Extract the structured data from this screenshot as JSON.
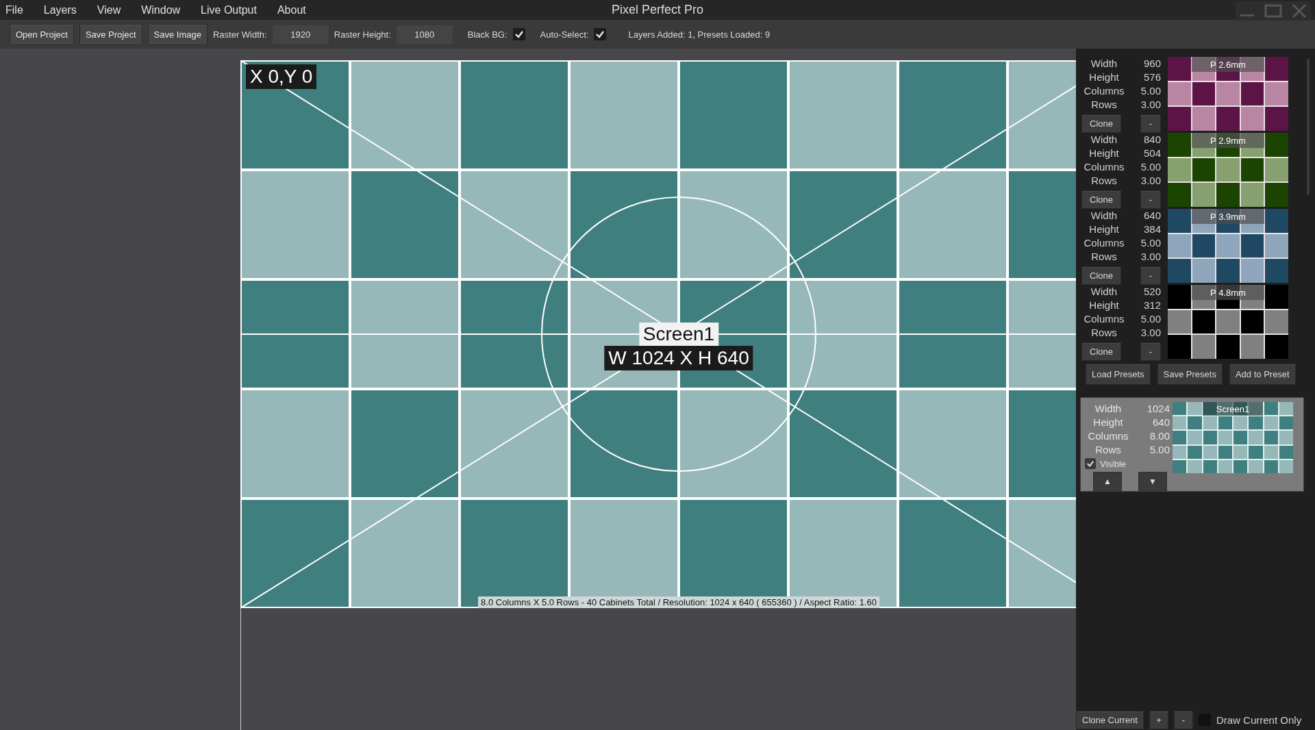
{
  "menu": [
    "File",
    "Layers",
    "View",
    "Window",
    "Live Output",
    "About"
  ],
  "title": "Pixel Perfect Pro",
  "toolbar": {
    "buttons": [
      "Open Project",
      "Save Project",
      "Save Image"
    ],
    "raster_width": {
      "label": "Raster Width:",
      "value": "1920"
    },
    "raster_height": {
      "label": "Raster Height:",
      "value": "1080"
    },
    "black_bg": {
      "label": "Black BG:",
      "checked": true
    },
    "auto_select": {
      "label": "Auto-Select:",
      "checked": true
    },
    "status": "Layers Added: 1, Presets Loaded: 9"
  },
  "canvas": {
    "origin_label": "X 0,Y 0",
    "screen_name": "Screen1",
    "size_label": "W 1024 X H 640",
    "status": "8.0 Columns X 5.0 Rows - 40 Cabinets Total / Resolution: 1024 x 640 ( 655360 ) / Aspect Ratio: 1.60"
  },
  "presets": [
    {
      "fields": [
        {
          "label": "Width",
          "value": "960"
        },
        {
          "label": "Height",
          "value": "576"
        },
        {
          "label": "Columns",
          "value": "5.00"
        },
        {
          "label": "Rows",
          "value": "3.00"
        }
      ],
      "pitch": "P 2.6mm",
      "tiles": [
        {
          "color": "#5c1346"
        },
        {
          "color": "#b886a3"
        }
      ],
      "clone": "Clone",
      "remove": "-"
    },
    {
      "fields": [
        {
          "label": "Width",
          "value": "840"
        },
        {
          "label": "Height",
          "value": "504"
        },
        {
          "label": "Columns",
          "value": "5.00"
        },
        {
          "label": "Rows",
          "value": "3.00"
        }
      ],
      "pitch": "P 2.9mm",
      "tiles": [
        {
          "color": "#1a4400"
        },
        {
          "color": "#86a070"
        }
      ],
      "clone": "Clone",
      "remove": "-"
    },
    {
      "fields": [
        {
          "label": "Width",
          "value": "640"
        },
        {
          "label": "Height",
          "value": "384"
        },
        {
          "label": "Columns",
          "value": "5.00"
        },
        {
          "label": "Rows",
          "value": "3.00"
        }
      ],
      "pitch": "P 3.9mm",
      "tiles": [
        {
          "color": "#1f4862"
        },
        {
          "color": "#8ea6bb"
        }
      ],
      "clone": "Clone",
      "remove": "-"
    },
    {
      "fields": [
        {
          "label": "Width",
          "value": "520"
        },
        {
          "label": "Height",
          "value": "312"
        },
        {
          "label": "Columns",
          "value": "5.00"
        },
        {
          "label": "Rows",
          "value": "3.00"
        }
      ],
      "pitch": "P 4.8mm",
      "tiles": [
        {
          "color": "#000000"
        },
        {
          "color": "#808080"
        }
      ],
      "clone": "Clone",
      "remove": "-"
    }
  ],
  "preset_buttons": [
    "Load Presets",
    "Save Presets",
    "Add to Preset"
  ],
  "layer": {
    "fields": [
      {
        "label": "Width",
        "value": "1024"
      },
      {
        "label": "Height",
        "value": "640"
      },
      {
        "label": "Columns",
        "value": "8.00"
      },
      {
        "label": "Rows",
        "value": "5.00"
      }
    ],
    "name": "Screen1",
    "tiles": [
      {
        "color": "#407f7f"
      },
      {
        "color": "#97b8b8"
      }
    ],
    "visible": {
      "label": "Visible",
      "checked": true
    },
    "move_up": "▲",
    "move_down": "▼"
  },
  "bottom_bar": {
    "clone_current": "Clone Current",
    "add": "+",
    "remove": "-",
    "draw_current_only": {
      "label": "Draw Current Only",
      "checked": false
    }
  }
}
